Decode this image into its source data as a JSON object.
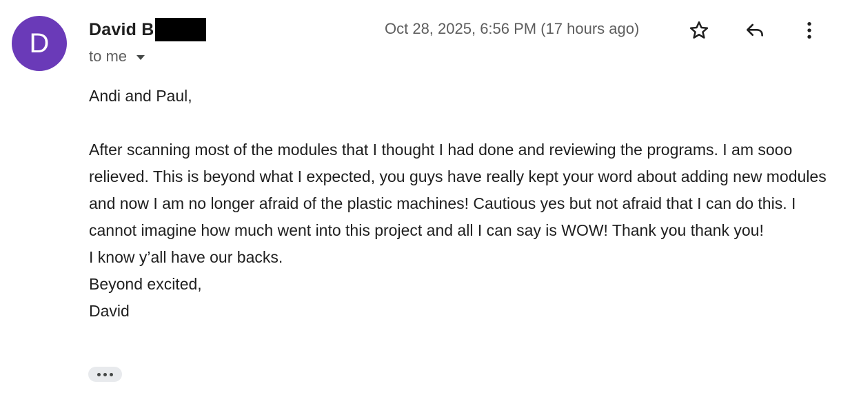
{
  "sender": {
    "avatar_letter": "D",
    "avatar_color": "#6a3ab8",
    "name_visible": "David B",
    "name_redacted": true
  },
  "recipient": {
    "label": "to me"
  },
  "timestamp": "Oct 28, 2025, 6:56 PM (17 hours ago)",
  "actions": {
    "star_icon": "star-outline-icon",
    "reply_icon": "reply-arrow-icon",
    "more_icon": "more-vertical-icon"
  },
  "body": {
    "greeting": "Andi and Paul,",
    "paragraph": "After scanning most of the modules that I thought I had done and reviewing the programs. I am sooo relieved. This is beyond what I expected, you guys have really kept your word about adding new modules and now I am no longer afraid of the plastic machines! Cautious yes but not afraid that I can do this. I cannot imagine how much went into this project and all I can say is WOW! Thank you thank you!",
    "line2": "I know y’all have our backs.",
    "closing": "Beyond excited,",
    "signature": "David"
  },
  "trimmed_content_icon": "ellipsis-icon"
}
